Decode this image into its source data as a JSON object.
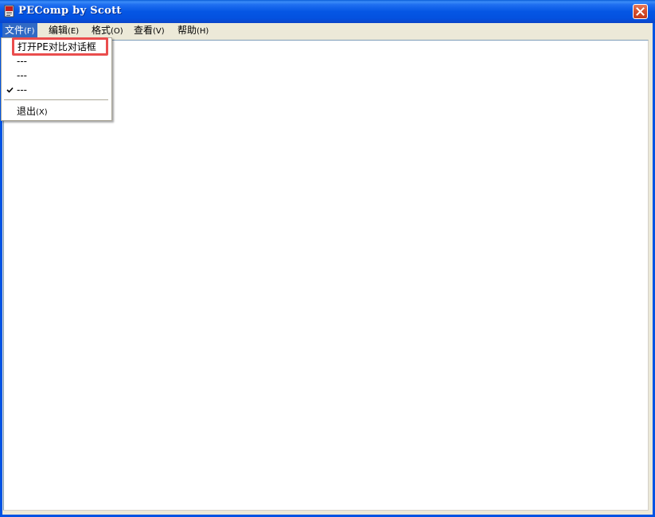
{
  "window": {
    "title": "PEComp by Scott"
  },
  "menubar": {
    "items": [
      {
        "label": "文件",
        "accel": "(F)"
      },
      {
        "label": "编辑",
        "accel": "(E)"
      },
      {
        "label": "格式",
        "accel": "(O)"
      },
      {
        "label": "查看",
        "accel": "(V)"
      },
      {
        "label": "帮助",
        "accel": "(H)"
      }
    ],
    "active_index": 0
  },
  "file_menu": {
    "items": [
      {
        "label": "打开PE对比对话框",
        "highlighted": true
      },
      {
        "label": "---"
      },
      {
        "label": "---"
      },
      {
        "label": "---",
        "checked": true
      }
    ],
    "exit": {
      "label": "退出",
      "accel": "(X)"
    }
  },
  "icons": {
    "app": "app-icon",
    "close": "close-icon",
    "check": "checkmark-icon"
  },
  "colors": {
    "titlebar": "#0054e3",
    "menu_active": "#316ac5",
    "close_button": "#d5512f",
    "highlight_box": "#ea4d4d"
  }
}
